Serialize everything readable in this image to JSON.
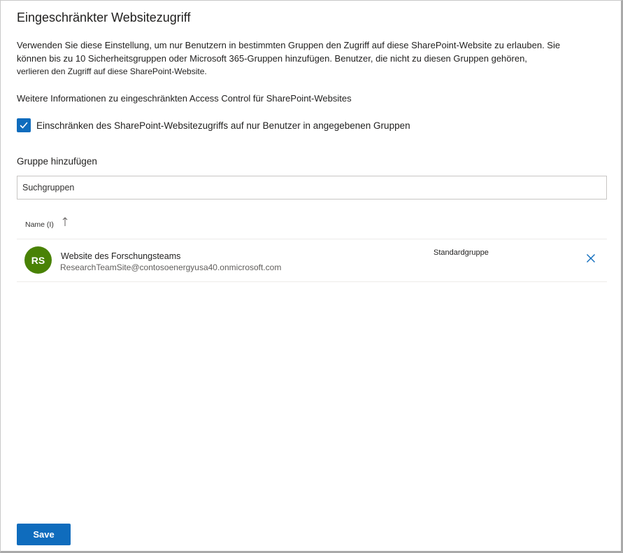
{
  "panel": {
    "title": "Eingeschränkter Websitezugriff",
    "description_lines": [
      "Verwenden Sie diese Einstellung, um nur Benutzern in bestimmten Gruppen den Zugriff auf diese SharePoint-Website zu erlauben. Sie",
      "können bis zu 10 Sicherheitsgruppen oder Microsoft 365-Gruppen hinzufügen. Benutzer, die nicht zu diesen Gruppen gehören,",
      "verlieren den Zugriff auf diese SharePoint-Website."
    ],
    "learn_more_link": "Weitere Informationen zu eingeschränkten Access Control für SharePoint-Websites"
  },
  "restrict_checkbox": {
    "label": "Einschränken des SharePoint-Websitezugriffs auf nur Benutzer in angegebenen Gruppen",
    "checked": true
  },
  "add_group": {
    "label": "Gruppe hinzufügen",
    "placeholder": "Suchgruppen",
    "value": ""
  },
  "table": {
    "column_name": "Name (I)",
    "sort_icon": "arrow-up-icon",
    "rows": [
      {
        "initials": "RS",
        "avatar_color": "#498205",
        "name": "Website des Forschungsteams",
        "email": "ResearchTeamSite@contosoenergyusa40.onmicrosoft.com",
        "type": "Standardgruppe",
        "remove_icon": "close-icon"
      }
    ]
  },
  "footer": {
    "save_label": "Save"
  },
  "colors": {
    "accent": "#0f6cbd",
    "avatar": "#498205",
    "divider": "#edebe9"
  }
}
